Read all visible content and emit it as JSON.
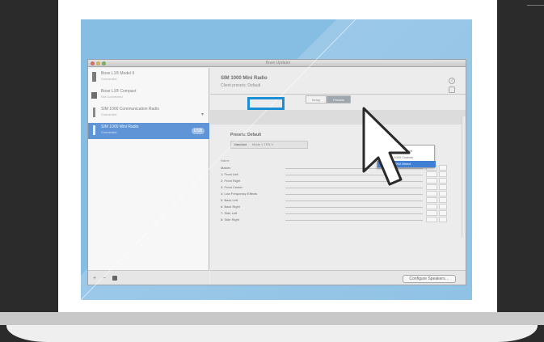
{
  "colors": {
    "background": "#2b2b2b",
    "panel_blue": "#86bde3",
    "selection_blue": "#5f95d6",
    "highlight_box": "#1a8fd6"
  },
  "window": {
    "title": "Bose Updater"
  },
  "sidebar": {
    "devices": [
      {
        "name": "Bose L1® Model II",
        "status": "Connected",
        "icon": "speaker-icon"
      },
      {
        "name": "Bose L1® Compact",
        "status": "Not Connected",
        "icon": "speaker-icon"
      },
      {
        "name": "SIM 1000 Communication Radio",
        "status": "Connected",
        "icon": "microphone-icon"
      },
      {
        "name": "SIM 1000 Mini Radio",
        "status": "Connected",
        "icon": "microphone-icon",
        "badge": "USB",
        "selected": true
      }
    ],
    "bottom_buttons": [
      "+",
      "−"
    ]
  },
  "main": {
    "title": "SIM 1000 Mini Radio",
    "subtitle": "Client presets: Default",
    "info_icon": "info-icon",
    "segments": [
      "Setup",
      "Presets"
    ],
    "active_segment": 1,
    "presets_label": "Presets: Default",
    "preset_row": {
      "label": "Standard",
      "value": "Mode 1 TEN V"
    },
    "dropdown_options": [
      "SIM 1000 Default",
      "SIM 1000 Custom",
      "SIM 1000 Mixed"
    ],
    "dropdown_selected": 2,
    "table_header": "Name",
    "channels": [
      "Master",
      "1: Front Left",
      "2: Front Right",
      "3: Front Center",
      "4: Low Frequency Effects",
      "5: Back Left",
      "6: Back Right",
      "7: Side Left",
      "8: Side Right"
    ],
    "configure_button": "Configure Speakers…"
  },
  "cursor": {
    "icon": "arrow-cursor-icon"
  }
}
